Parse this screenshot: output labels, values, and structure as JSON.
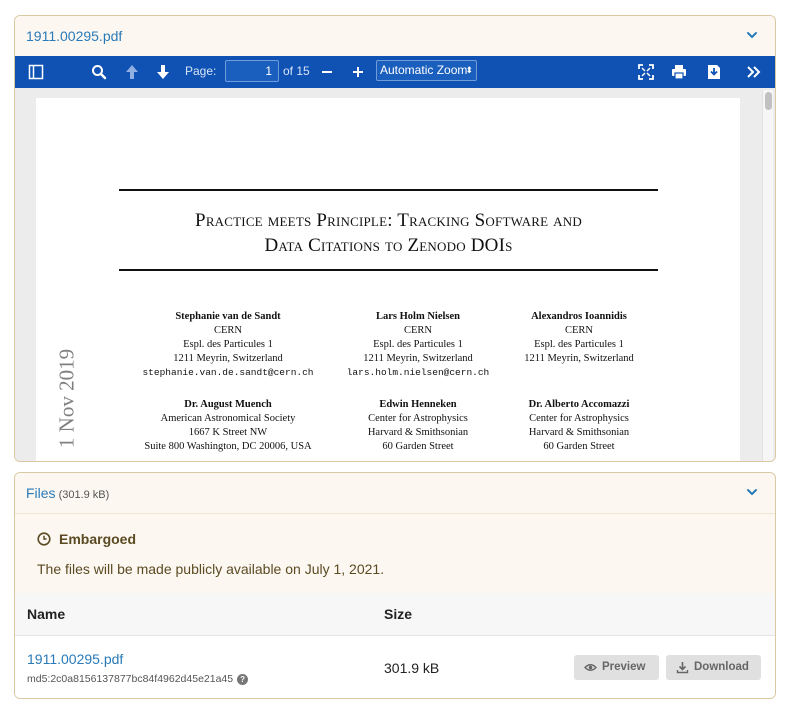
{
  "preview_panel": {
    "title": "1911.00295.pdf"
  },
  "toolbar": {
    "page_label": "Page:",
    "page_value": "1",
    "page_total": "of 15",
    "zoom_value": "Automatic Zoom"
  },
  "pdf": {
    "title_line1": "Practice meets Principle: Tracking Software and",
    "title_line2": "Data Citations to Zenodo DOIs",
    "arxiv_stamp": "1 Nov 2019",
    "authors": [
      {
        "name": "Stephanie van de Sandt",
        "l1": "CERN",
        "l2": "Espl. des Particules 1",
        "l3": "1211 Meyrin, Switzerland",
        "email": "stephanie.van.de.sandt@cern.ch"
      },
      {
        "name": "Lars Holm Nielsen",
        "l1": "CERN",
        "l2": "Espl. des Particules 1",
        "l3": "1211 Meyrin, Switzerland",
        "email": "lars.holm.nielsen@cern.ch"
      },
      {
        "name": "Alexandros Ioannidis",
        "l1": "CERN",
        "l2": "Espl. des Particules 1",
        "l3": "1211 Meyrin, Switzerland",
        "email": ""
      },
      {
        "name": "Dr. August Muench",
        "l1": "American Astronomical Society",
        "l2": "1667 K Street NW",
        "l3": "Suite 800 Washington, DC 20006, USA",
        "email": ""
      },
      {
        "name": "Edwin Henneken",
        "l1": "Center for Astrophysics",
        "l2": "Harvard & Smithsonian",
        "l3": "60 Garden Street",
        "email": ""
      },
      {
        "name": "Dr. Alberto Accomazzi",
        "l1": "Center for Astrophysics",
        "l2": "Harvard & Smithsonian",
        "l3": "60 Garden Street",
        "email": ""
      }
    ]
  },
  "files_panel": {
    "title": "Files",
    "size_note": "(301.9 kB)",
    "embargo_title": "Embargoed",
    "embargo_message": "The files will be made publicly available on July 1, 2021.",
    "columns": {
      "name": "Name",
      "size": "Size"
    },
    "file": {
      "name": "1911.00295.pdf",
      "md5": "md5:2c0a8156137877bc84f4962d45e21a45",
      "size": "301.9 kB",
      "preview_label": "Preview",
      "download_label": "Download"
    }
  },
  "colors": {
    "toolbar": "#0f52b3",
    "link": "#2a7ab8",
    "panel_border": "#d9c9a2",
    "embargo_bg": "#fcf8f1"
  },
  "icons": [
    "chevron-down-icon",
    "sidebar-toggle-icon",
    "search-icon",
    "arrow-up-icon",
    "arrow-down-icon",
    "minus-icon",
    "plus-icon",
    "fullscreen-icon",
    "print-icon",
    "save-icon",
    "double-chevron-right-icon",
    "clock-icon",
    "eye-icon",
    "download-icon",
    "question-icon"
  ]
}
